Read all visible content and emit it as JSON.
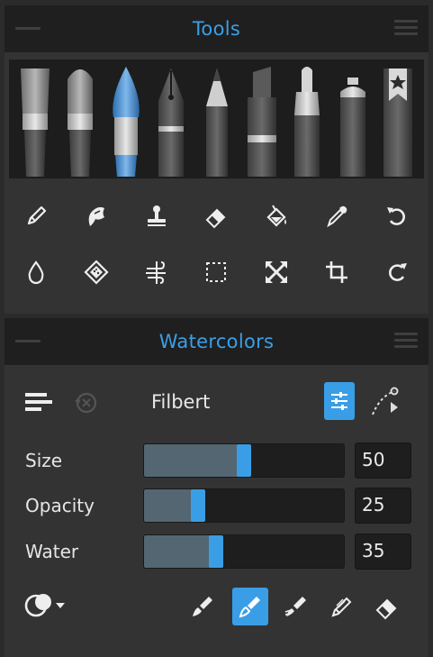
{
  "tools_panel": {
    "title": "Tools",
    "brushes": [
      {
        "icon": "flat-brush-icon",
        "selected": false
      },
      {
        "icon": "round-bristle-brush-icon",
        "selected": false
      },
      {
        "icon": "watercolor-brush-icon",
        "selected": true
      },
      {
        "icon": "ink-pen-icon",
        "selected": false
      },
      {
        "icon": "pencil-icon",
        "selected": false
      },
      {
        "icon": "marker-icon",
        "selected": false
      },
      {
        "icon": "felt-pen-icon",
        "selected": false
      },
      {
        "icon": "spray-can-icon",
        "selected": false
      },
      {
        "icon": "favorites-bookmark-icon",
        "selected": false
      }
    ],
    "tool_row_1": [
      "pen-icon",
      "smudge-icon",
      "stamp-icon",
      "eraser-icon",
      "fill-bucket-icon",
      "eyedropper-icon",
      "undo-icon"
    ],
    "tool_row_2": [
      "water-drop-icon",
      "texture-icon",
      "wind-icon",
      "selection-icon",
      "transform-icon",
      "crop-icon",
      "redo-icon"
    ]
  },
  "watercolors_panel": {
    "title": "Watercolors",
    "brush_name": "Filbert",
    "sliders": {
      "size": {
        "label": "Size",
        "value": "50",
        "fraction": 0.5
      },
      "opacity": {
        "label": "Opacity",
        "value": "25",
        "fraction": 0.25
      },
      "water": {
        "label": "Water",
        "value": "35",
        "fraction": 0.35
      }
    },
    "modes": [
      {
        "icon": "paint-mode-icon",
        "active": false
      },
      {
        "icon": "paint-plus-mode-icon",
        "active": true
      },
      {
        "icon": "wet-paint-mode-icon",
        "active": false
      },
      {
        "icon": "dry-mode-icon",
        "active": false
      },
      {
        "icon": "erase-mode-icon",
        "active": false
      }
    ]
  },
  "colors": {
    "accent": "#3a9ee6",
    "header_bg": "#1f1f1f",
    "panel_bg": "#333333"
  }
}
